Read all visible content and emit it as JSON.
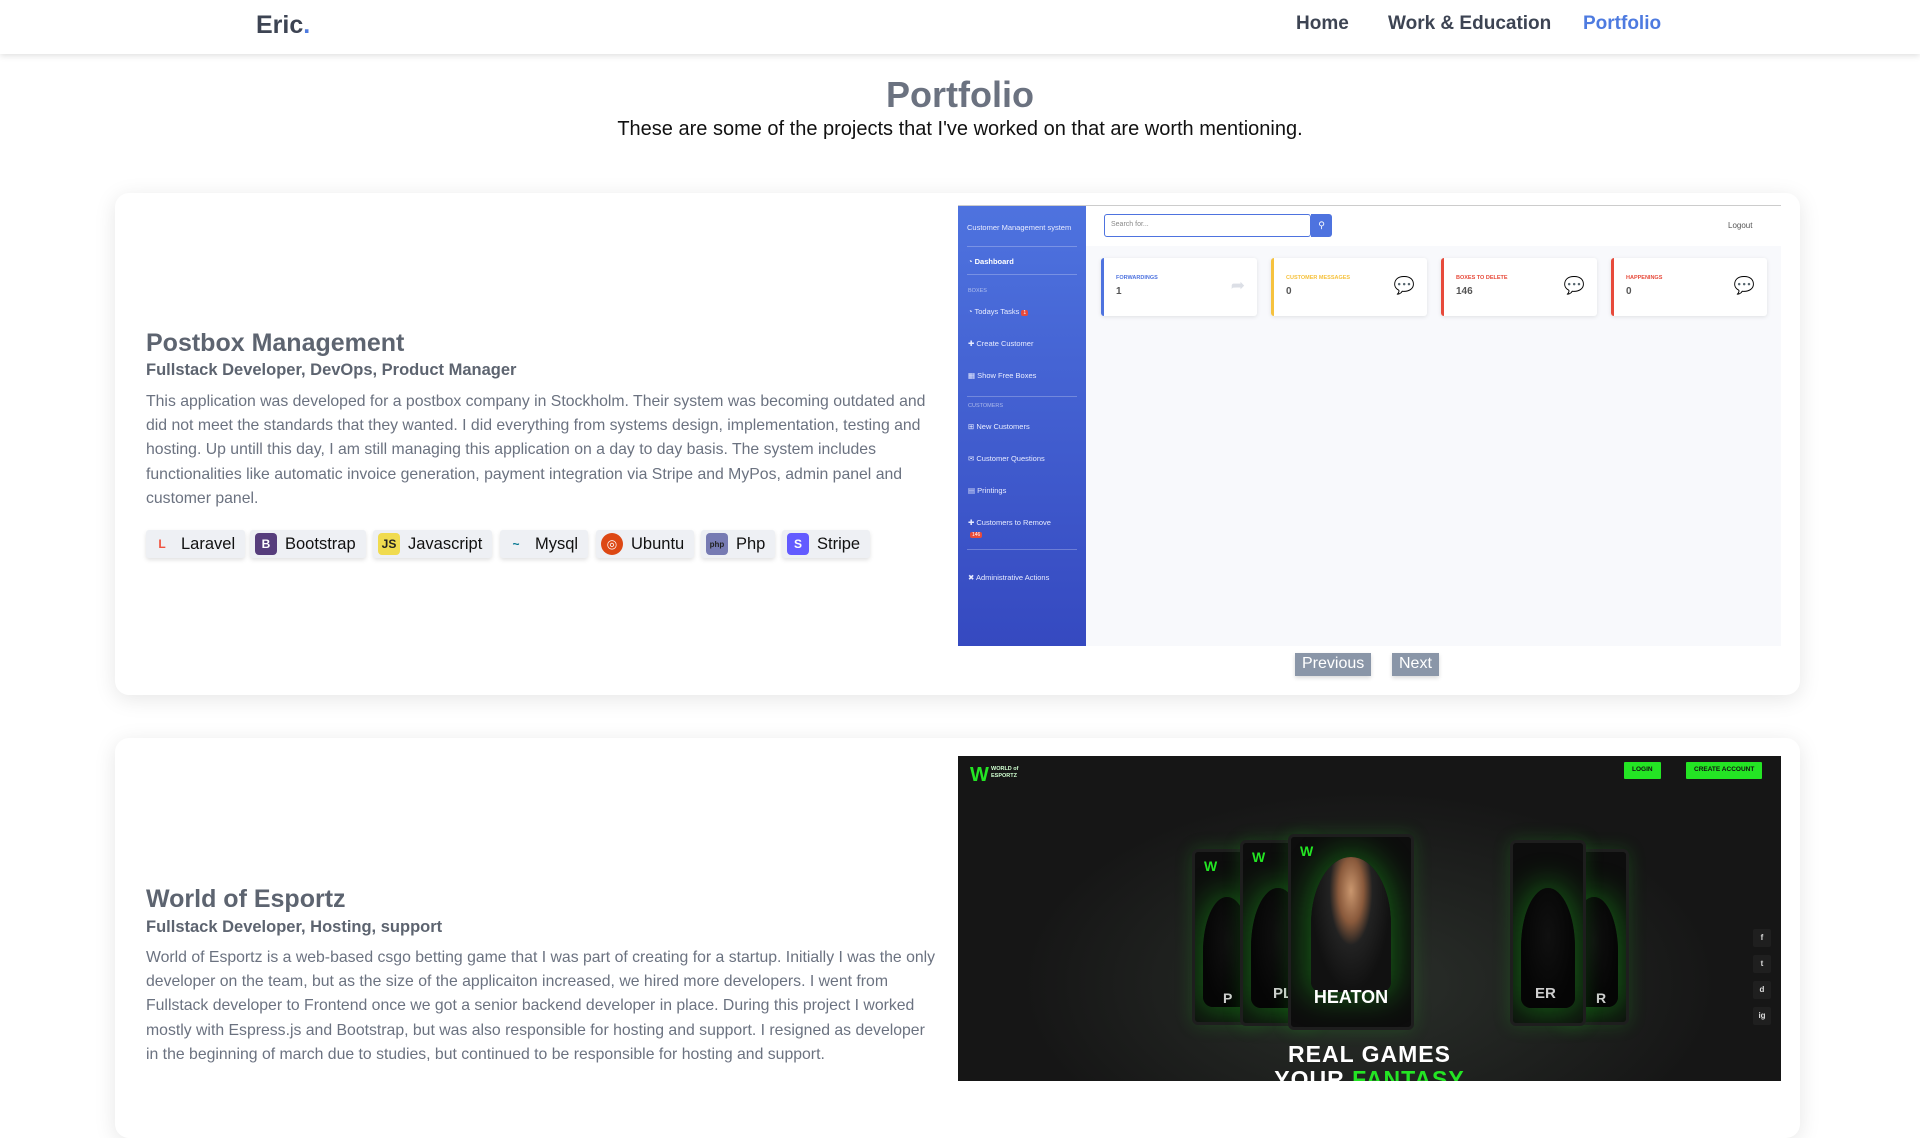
{
  "nav": {
    "brand": "Eric",
    "brand_dot": ".",
    "links": [
      "Home",
      "Work & Education",
      "Portfolio"
    ],
    "active": "Portfolio"
  },
  "header": {
    "title": "Portfolio",
    "subtitle": "These are some of the projects that I've worked on that are worth mentioning."
  },
  "projects": [
    {
      "title": "Postbox Management",
      "role": "Fullstack Developer, DevOps, Product Manager",
      "description": "This application was developed for a postbox company in Stockholm. Their system was becoming outdated and did not meet the standards that they wanted. I did everything from systems design, implementation, testing and hosting. Up untill this day, I am still managing this application on a day to day basis. The system includes functionalities like automatic invoice generation, payment integration via Stripe and MyPos, admin panel and customer panel.",
      "tech": [
        {
          "label": "Laravel",
          "icon": "laravel-icon",
          "color": "#f05340",
          "glyph": "L"
        },
        {
          "label": "Bootstrap",
          "icon": "bootstrap-icon",
          "color": "#563d7c",
          "glyph": "B"
        },
        {
          "label": "Javascript",
          "icon": "javascript-icon",
          "color": "#f0db4f",
          "glyph": "JS"
        },
        {
          "label": "Mysql",
          "icon": "mysql-icon",
          "color": "#00758f",
          "glyph": "~"
        },
        {
          "label": "Ubuntu",
          "icon": "ubuntu-icon",
          "color": "#dd4814",
          "glyph": "◎"
        },
        {
          "label": "Php",
          "icon": "php-icon",
          "color": "#777bb3",
          "glyph": "php"
        },
        {
          "label": "Stripe",
          "icon": "stripe-icon",
          "color": "#635bff",
          "glyph": "S"
        }
      ],
      "screenshot": {
        "sidebar_brand": "Customer Management system",
        "sidebar": {
          "dashboard": "Dashboard",
          "section_boxes": "BOXES",
          "todays_tasks": "Todays Tasks",
          "todays_tasks_badge": "1",
          "create_customer": "Create Customer",
          "show_free_boxes": "Show Free Boxes",
          "section_customers": "CUSTOMERS",
          "new_customers": "New Customers",
          "customer_questions": "Customer Questions",
          "printings": "Printings",
          "customers_to_remove": "Customers to Remove",
          "customers_to_remove_badge": "146",
          "administrative_actions": "Administrative Actions"
        },
        "search_placeholder": "Search for...",
        "logout": "Logout",
        "stats": [
          {
            "label": "FORWARDINGS",
            "value": "1",
            "color": "#4e73df"
          },
          {
            "label": "CUSTOMER MESSAGES",
            "value": "0",
            "color": "#f6c23e"
          },
          {
            "label": "BOXES TO DELETE",
            "value": "146",
            "color": "#e74a3b"
          },
          {
            "label": "HAPPENINGS",
            "value": "0",
            "color": "#e74a3b"
          }
        ]
      },
      "pager": {
        "previous": "Previous",
        "next": "Next"
      }
    },
    {
      "title": "World of Esportz",
      "role": "Fullstack Developer, Hosting, support",
      "description": "World of Esportz is a web-based csgo betting game that I was part of creating for a startup. Initially I was the only developer on the team, but as the size of the applicaiton increased, we hired more developers. I went from Fullstack developer to Frontend once we got a senior backend developer in place. During this project I worked mostly with Espress.js and Bootstrap, but was also responsible for hosting and support. I resigned as developer in the beginning of march due to studies, but continued to be responsible for hosting and support.",
      "screenshot": {
        "logo_line1": "WORLD of",
        "logo_line2": "ESPORTZ",
        "login": "LOGIN",
        "create_account": "CREATE ACCOUNT",
        "card_names": [
          "P",
          "PL",
          "HEATON",
          "ER",
          "R"
        ],
        "headline_line1": "REAL GAMES",
        "headline_line2_a": "YOUR ",
        "headline_line2_b": "FANTASY",
        "social": [
          "f",
          "t",
          "d",
          "ig"
        ]
      }
    }
  ]
}
